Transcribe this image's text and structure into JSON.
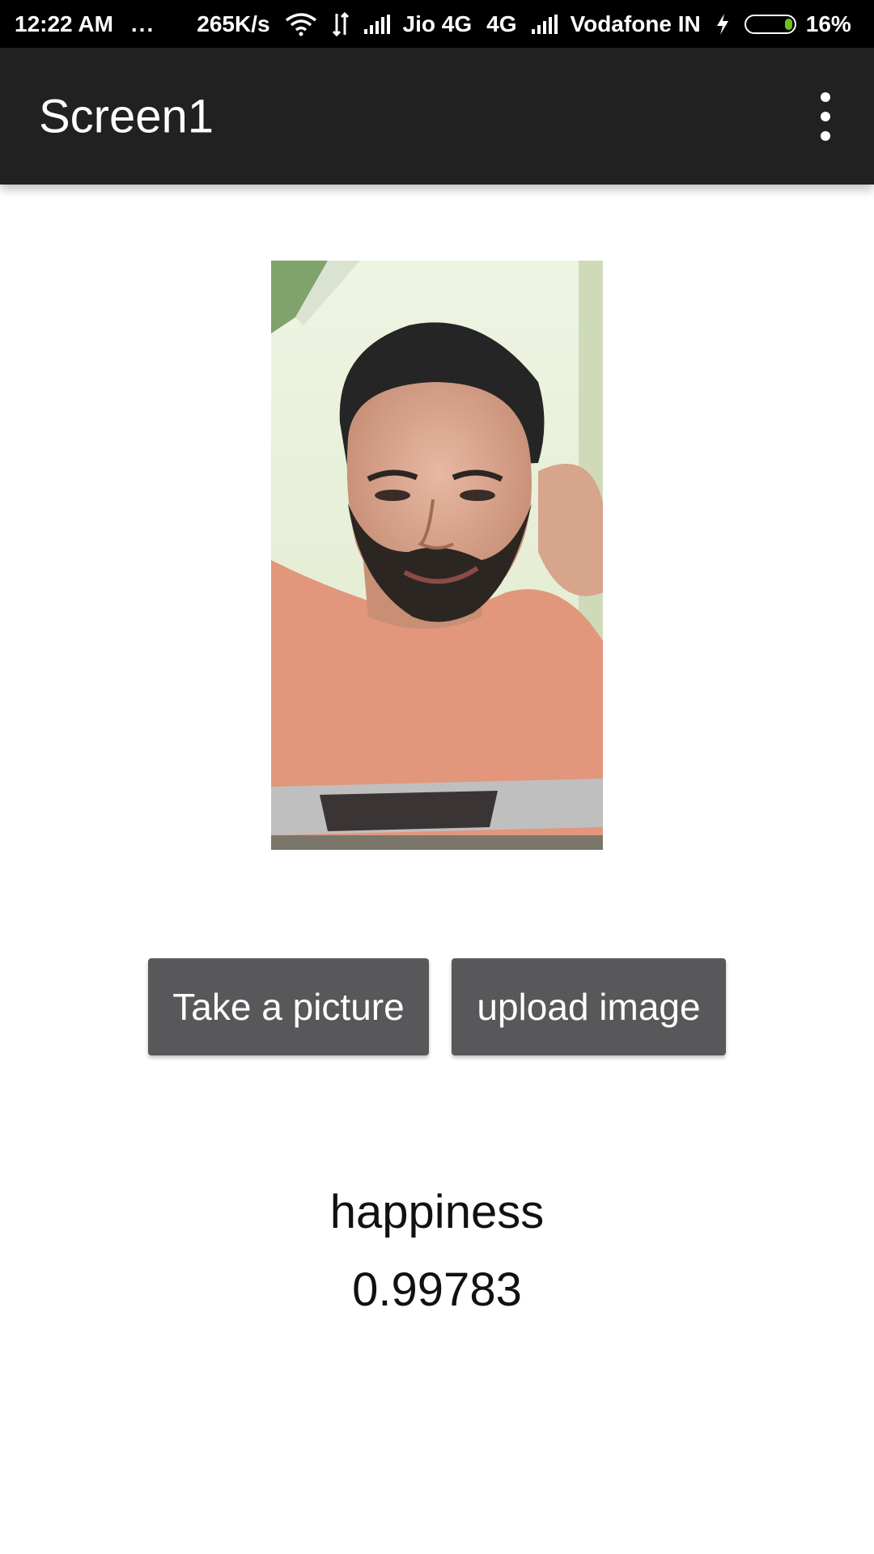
{
  "status_bar": {
    "time": "12:22 AM",
    "dots": "...",
    "speed": "265K/s",
    "carrier1": "Jio 4G",
    "network_type": "4G",
    "carrier2": "Vodafone IN",
    "battery": "16%",
    "icons": [
      "wifi-icon",
      "data-transfer-icon",
      "signal-icon",
      "charging-icon",
      "battery-icon"
    ],
    "battery_level": 0.16,
    "battery_color": "#6bc21e"
  },
  "app_bar": {
    "title": "Screen1",
    "menu_icon": "more-vert-icon",
    "background": "#212121"
  },
  "photo": {
    "description_icon": "selfie-photo"
  },
  "buttons": {
    "take_picture": "Take a picture",
    "upload_image": "upload image",
    "color": "#58575a"
  },
  "result": {
    "label": "happiness",
    "value": "0.99783"
  }
}
